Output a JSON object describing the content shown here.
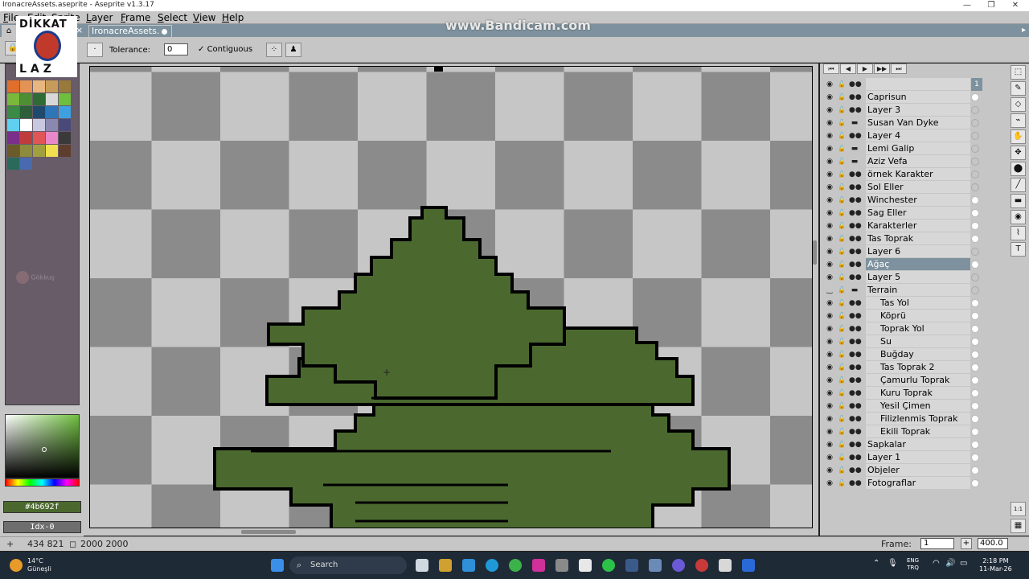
{
  "window": {
    "title": "IronacreAssets.aseprite - Aseprite v1.3.17",
    "minimize": "—",
    "maximize": "❐",
    "close": "✕"
  },
  "watermark": "www.Bandicam.com",
  "logo": {
    "line1": "DİKKAT",
    "line2": "LAZ"
  },
  "ghost_user": "Gökkuş",
  "menu": [
    "File",
    "Edit",
    "Sprite",
    "Layer",
    "Frame",
    "Select",
    "View",
    "Help"
  ],
  "tabs": {
    "home": "⌂",
    "doc_title": "IronacreAssets.",
    "close": "×",
    "scroll": "▸"
  },
  "contextbar": {
    "tolerance_label": "Tolerance:",
    "tolerance_value": "0",
    "contiguous_label": "Contiguous",
    "contiguous_checked": "✓"
  },
  "palette": {
    "swatches": [
      "#e06f2b",
      "#e39455",
      "#e8b67f",
      "#c79c5a",
      "#9a7a3b",
      "#7ab83b",
      "#4f8f34",
      "#2f6b35",
      "#d8d8d8",
      "#6fbf3f",
      "#3b8a46",
      "#2c5f3a",
      "#1f4a6b",
      "#2f76b8",
      "#3ea0e0",
      "#5fd0f0",
      "#ffffff",
      "#c8c8e0",
      "#8888b0",
      "#4a4a7a",
      "#7a2f8a",
      "#c03c3c",
      "#e05555",
      "#e888c8",
      "#3a3a3a",
      "#6b5a2a",
      "#8c8c3c",
      "#a0a040",
      "#f0e050",
      "#5e3d2d",
      "#2a6a5a",
      "#4a6ab0"
    ],
    "hex": "#4b692f",
    "index": "Idx-0"
  },
  "colors": {
    "foliage": "#4b692f",
    "outline": "#000000",
    "checker_light": "#c6c6c6",
    "checker_dark": "#8b8b8b"
  },
  "layers": [
    {
      "name": "",
      "type": "header",
      "frame": "1"
    },
    {
      "name": "Caprisun",
      "type": "layer"
    },
    {
      "name": "Layer 3",
      "type": "layer"
    },
    {
      "name": "Susan Van Dyke",
      "type": "folder"
    },
    {
      "name": "Layer 4",
      "type": "layer"
    },
    {
      "name": "Lemi Galip",
      "type": "folder"
    },
    {
      "name": "Aziz Vefa",
      "type": "folder"
    },
    {
      "name": "örnek Karakter",
      "type": "layer"
    },
    {
      "name": "Sol Eller",
      "type": "layer"
    },
    {
      "name": "Winchester",
      "type": "layer"
    },
    {
      "name": "Sag Eller",
      "type": "layer"
    },
    {
      "name": "Karakterler",
      "type": "layer"
    },
    {
      "name": "Tas Toprak",
      "type": "layer"
    },
    {
      "name": "Layer 6",
      "type": "layer"
    },
    {
      "name": "Ağaç",
      "type": "layer",
      "selected": true
    },
    {
      "name": "Layer 5",
      "type": "layer"
    },
    {
      "name": "Terrain",
      "type": "group-open"
    },
    {
      "name": "Tas Yol",
      "type": "child"
    },
    {
      "name": "Köprü",
      "type": "child"
    },
    {
      "name": "Toprak Yol",
      "type": "child"
    },
    {
      "name": "Su",
      "type": "child"
    },
    {
      "name": "Buğday",
      "type": "child"
    },
    {
      "name": "Tas Toprak 2",
      "type": "child"
    },
    {
      "name": "Çamurlu Toprak",
      "type": "child"
    },
    {
      "name": "Kuru Toprak",
      "type": "child"
    },
    {
      "name": "Yesil Çimen",
      "type": "child"
    },
    {
      "name": "Filizlenmis Toprak",
      "type": "child"
    },
    {
      "name": "Ekili Toprak",
      "type": "child"
    },
    {
      "name": "Sapkalar",
      "type": "layer"
    },
    {
      "name": "Layer 1",
      "type": "layer"
    },
    {
      "name": "Objeler",
      "type": "layer"
    },
    {
      "name": "Fotograflar",
      "type": "layer"
    }
  ],
  "timeline_nav": [
    "⏮",
    "◀",
    "▶",
    "▶▶",
    "⏭"
  ],
  "tools": [
    "⬚",
    "✎",
    "◇",
    "⌁",
    "✋",
    "✥",
    "⬤",
    "╱",
    "▬",
    "◉",
    "⌇",
    "T"
  ],
  "statusbar": {
    "coords": "434  821",
    "size": "2000  2000",
    "frame_label": "Frame:",
    "frame_value": "1",
    "zoom": "400.0"
  },
  "taskbar": {
    "weather_temp": "14°C",
    "weather_place": "Güneşli",
    "search": "Search",
    "lang1": "ENG",
    "lang2": "TRQ",
    "time": "2:18 PM",
    "date": "11-Mar-26"
  }
}
